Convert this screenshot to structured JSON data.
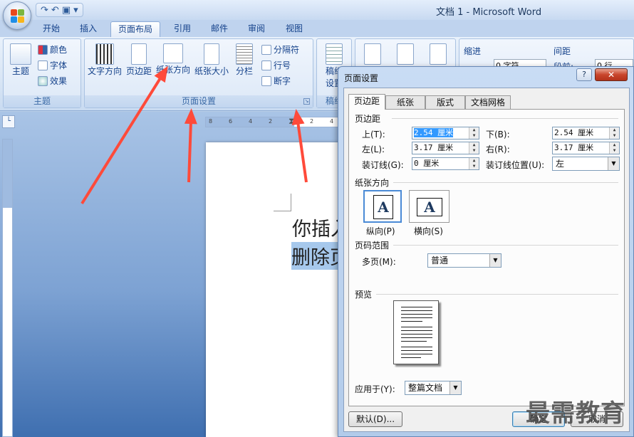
{
  "window": {
    "title": "文档 1 - Microsoft Word"
  },
  "qat": {
    "undo": "↶",
    "redo": "↷",
    "save": "▣",
    "customize": "▾"
  },
  "tabs": [
    {
      "label": "开始"
    },
    {
      "label": "插入"
    },
    {
      "label": "页面布局"
    },
    {
      "label": "引用"
    },
    {
      "label": "邮件"
    },
    {
      "label": "审阅"
    },
    {
      "label": "视图"
    }
  ],
  "ribbon": {
    "theme_group": {
      "label": "主题",
      "themes": "主题",
      "colors": "颜色",
      "fonts": "字体",
      "effects": "效果"
    },
    "page_setup_group": {
      "label": "页面设置",
      "text_direction": "文字方向",
      "margins": "页边距",
      "orientation": "纸张方向",
      "size": "纸张大小",
      "columns": "分栏",
      "breaks": "分隔符",
      "line_numbers": "行号",
      "hyphenation": "断字"
    },
    "draft_group": {
      "label": "稿纸",
      "draft_line1": "稿纸",
      "draft_line2": "设置"
    },
    "paragraph": {
      "indent": "缩进",
      "spacing": "间距",
      "indent_left_value": "0 字符",
      "spacing_before_label": "段前:",
      "spacing_before_value": "0 行"
    }
  },
  "ruler": {
    "ticks": [
      "8",
      "6",
      "4",
      "2",
      "2",
      "4"
    ]
  },
  "document": {
    "line1": "你插入",
    "line2": "删除页"
  },
  "dialog": {
    "title": "页面设置",
    "help": "?",
    "close": "✕",
    "tabs": [
      {
        "label": "页边距"
      },
      {
        "label": "纸张"
      },
      {
        "label": "版式"
      },
      {
        "label": "文档网格"
      }
    ],
    "margins_section": "页边距",
    "top_label": "上(T):",
    "top_value_sel": "2.54 厘米",
    "top_value": "",
    "bottom_label": "下(B):",
    "bottom_value": "2.54 厘米",
    "left_label": "左(L):",
    "left_value": "3.17 厘米",
    "right_label": "右(R):",
    "right_value": "3.17 厘米",
    "gutter_label": "装订线(G):",
    "gutter_value": "0 厘米",
    "gutter_pos_label": "装订线位置(U):",
    "gutter_pos_value": "左",
    "orientation_section": "纸张方向",
    "portrait": "纵向(P)",
    "landscape": "横向(S)",
    "orientation_glyph": "A",
    "pages_section": "页码范围",
    "multiple_pages_label": "多页(M):",
    "multiple_pages_value": "普通",
    "preview_section": "预览",
    "apply_label": "应用于(Y):",
    "apply_value": "整篇文档",
    "default_button": "默认(D)...",
    "ok_button": "确定",
    "cancel_button": "取消"
  },
  "watermark": "最需教育"
}
